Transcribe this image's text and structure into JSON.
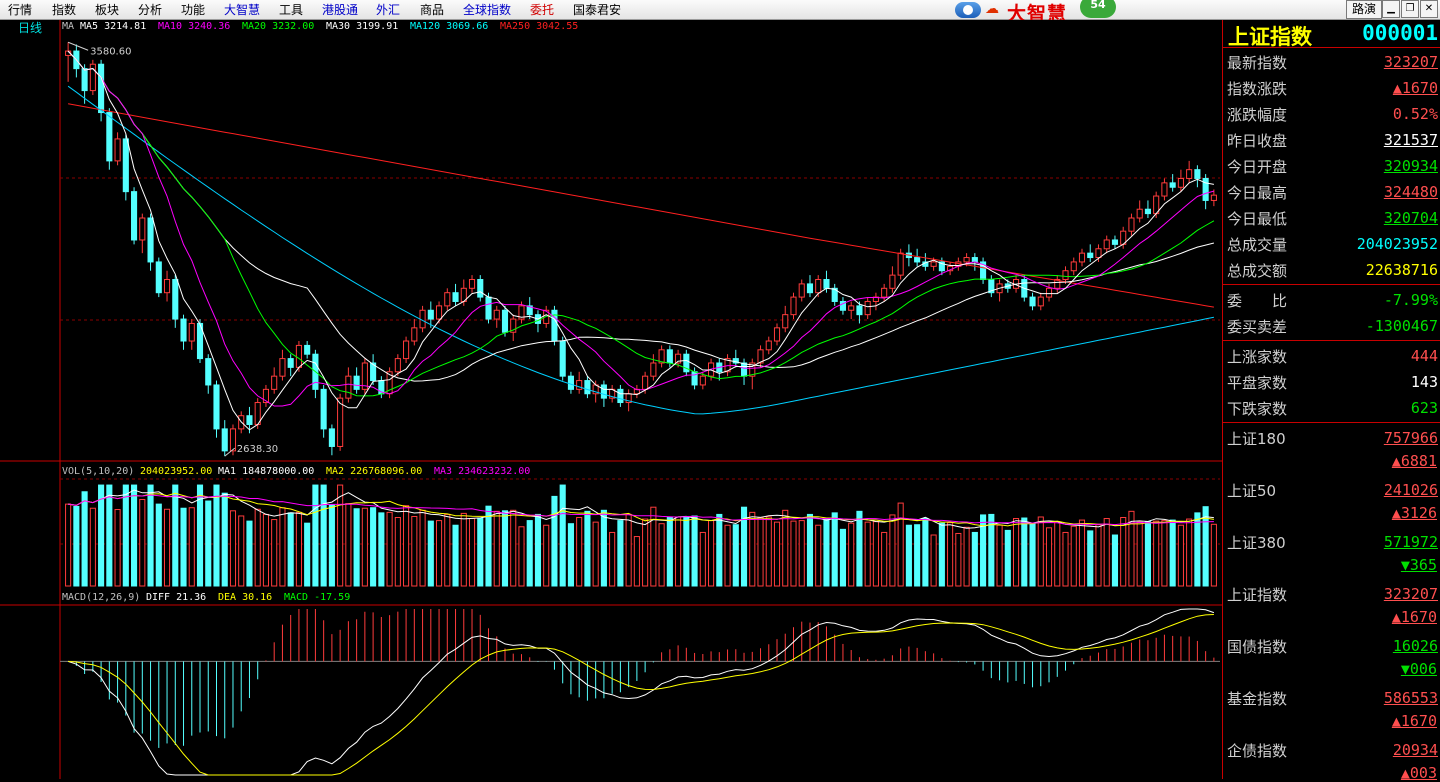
{
  "menu": [
    "行情",
    "指数",
    "板块",
    "分析",
    "功能",
    "大智慧",
    "工具",
    "港股通",
    "外汇",
    "商品",
    "全球指数",
    "委托",
    "国泰君安"
  ],
  "brand": {
    "name": "大智慧",
    "badge": "54"
  },
  "window_buttons": {
    "route": "路演",
    "minimize": "▁",
    "restore": "❐",
    "close": "✕"
  },
  "period_label": "日线",
  "price_legend": [
    {
      "text": "MA",
      "color": "#c0c0c0"
    },
    {
      "text": "MA5  3214.81",
      "color": "#ffffff"
    },
    {
      "text": "MA10  3240.36",
      "color": "#ff00ff"
    },
    {
      "text": "MA20  3232.00",
      "color": "#00ff00"
    },
    {
      "text": "MA30  3199.91",
      "color": "#ffffff"
    },
    {
      "text": "MA120  3069.66",
      "color": "#00ffff"
    },
    {
      "text": "MA250  3042.55",
      "color": "#ff2020"
    }
  ],
  "vol_legend": [
    {
      "text": "VOL(5,10,20)",
      "color": "#c0c0c0"
    },
    {
      "text": "204023952.00",
      "color": "#ffff00"
    },
    {
      "text": "MA1  184878000.00",
      "color": "#ffffff"
    },
    {
      "text": "MA2  226768096.00",
      "color": "#ffff00"
    },
    {
      "text": "MA3  234623232.00",
      "color": "#ff00ff"
    }
  ],
  "macd_legend": [
    {
      "text": "MACD(12,26,9)",
      "color": "#c0c0c0"
    },
    {
      "text": "DIFF  21.36",
      "color": "#ffffff"
    },
    {
      "text": "DEA  30.16",
      "color": "#ffff00"
    },
    {
      "text": "MACD  -17.59",
      "color": "#00ff00"
    }
  ],
  "high_label": "3580.60",
  "low_label": "2638.30",
  "quote": {
    "name": "上证指数",
    "code": "000001",
    "rows": [
      {
        "label": "最新指数",
        "value": "323207",
        "color": "red",
        "style": "ul"
      },
      {
        "label": "指数涨跌",
        "value": "▲1670",
        "color": "red",
        "style": "ul"
      },
      {
        "label": "涨跌幅度",
        "value": "0.52%",
        "color": "red",
        "style": ""
      },
      {
        "label": "昨日收盘",
        "value": "321537",
        "color": "white",
        "style": "ul"
      },
      {
        "label": "今日开盘",
        "value": "320934",
        "color": "green",
        "style": "ul"
      },
      {
        "label": "今日最高",
        "value": "324480",
        "color": "red",
        "style": "ul"
      },
      {
        "label": "今日最低",
        "value": "320704",
        "color": "green",
        "style": "ul"
      },
      {
        "label": "总成交量",
        "value": "204023952",
        "color": "cyan",
        "style": ""
      },
      {
        "label": "总成交额",
        "value": "22638716",
        "color": "yellow",
        "style": ""
      }
    ],
    "rows2": [
      {
        "label": "委　　比",
        "value": "-7.99%",
        "color": "green"
      },
      {
        "label": "委买卖差",
        "value": "-1300467",
        "color": "green"
      }
    ],
    "rows3": [
      {
        "label": "上涨家数",
        "value": "444",
        "color": "red"
      },
      {
        "label": "平盘家数",
        "value": "143",
        "color": "white"
      },
      {
        "label": "下跌家数",
        "value": "623",
        "color": "green"
      }
    ],
    "indices": [
      {
        "label": "上证180",
        "value": "757966",
        "change": "▲6881",
        "color": "red"
      },
      {
        "label": "上证50",
        "value": "241026",
        "change": "▲3126",
        "color": "red"
      },
      {
        "label": "上证380",
        "value": "571972",
        "change": "▼365",
        "color": "green"
      },
      {
        "label": "上证指数",
        "value": "323207",
        "change": "▲1670",
        "color": "red"
      },
      {
        "label": "国债指数",
        "value": "16026",
        "change": "▼006",
        "color": "green"
      },
      {
        "label": "基金指数",
        "value": "586553",
        "change": "▲1670",
        "color": "red"
      },
      {
        "label": "企债指数",
        "value": "20934",
        "change": "▲003",
        "color": "red"
      }
    ]
  },
  "chart_data": {
    "type": "candlestick",
    "title": "上证指数 日线",
    "price_range": [
      2638.3,
      3580.6
    ],
    "volume_max": 400000000,
    "macd_range": [
      -130,
      60
    ],
    "candles": [
      [
        3550,
        3560,
        3490,
        3580
      ],
      [
        3560,
        3520,
        3500,
        3575
      ],
      [
        3520,
        3470,
        3440,
        3530
      ],
      [
        3470,
        3530,
        3460,
        3540
      ],
      [
        3530,
        3420,
        3400,
        3540
      ],
      [
        3420,
        3310,
        3290,
        3430
      ],
      [
        3310,
        3360,
        3300,
        3375
      ],
      [
        3360,
        3240,
        3220,
        3370
      ],
      [
        3240,
        3130,
        3120,
        3250
      ],
      [
        3130,
        3180,
        3100,
        3190
      ],
      [
        3180,
        3080,
        3060,
        3190
      ],
      [
        3080,
        3010,
        3000,
        3090
      ],
      [
        3010,
        3040,
        2990,
        3060
      ],
      [
        3040,
        2950,
        2930,
        3050
      ],
      [
        2950,
        2900,
        2880,
        2960
      ],
      [
        2900,
        2940,
        2880,
        2950
      ],
      [
        2940,
        2860,
        2850,
        2950
      ],
      [
        2860,
        2800,
        2780,
        2870
      ],
      [
        2800,
        2700,
        2680,
        2810
      ],
      [
        2700,
        2650,
        2638,
        2720
      ],
      [
        2650,
        2700,
        2640,
        2710
      ],
      [
        2700,
        2730,
        2690,
        2740
      ],
      [
        2730,
        2710,
        2690,
        2750
      ],
      [
        2710,
        2760,
        2700,
        2770
      ],
      [
        2760,
        2790,
        2750,
        2800
      ],
      [
        2790,
        2820,
        2780,
        2840
      ],
      [
        2820,
        2860,
        2810,
        2880
      ],
      [
        2860,
        2840,
        2820,
        2870
      ],
      [
        2840,
        2890,
        2830,
        2900
      ],
      [
        2890,
        2870,
        2860,
        2900
      ],
      [
        2870,
        2790,
        2770,
        2880
      ],
      [
        2790,
        2700,
        2680,
        2800
      ],
      [
        2700,
        2660,
        2640,
        2710
      ],
      [
        2660,
        2770,
        2650,
        2780
      ],
      [
        2770,
        2820,
        2760,
        2840
      ],
      [
        2820,
        2790,
        2780,
        2840
      ],
      [
        2790,
        2850,
        2780,
        2860
      ],
      [
        2850,
        2810,
        2800,
        2870
      ],
      [
        2810,
        2780,
        2770,
        2820
      ],
      [
        2780,
        2830,
        2770,
        2840
      ],
      [
        2830,
        2860,
        2820,
        2870
      ],
      [
        2860,
        2900,
        2850,
        2910
      ],
      [
        2900,
        2930,
        2890,
        2950
      ],
      [
        2930,
        2970,
        2920,
        2980
      ],
      [
        2970,
        2950,
        2930,
        2990
      ],
      [
        2950,
        2980,
        2940,
        2990
      ],
      [
        2980,
        3010,
        2970,
        3020
      ],
      [
        3010,
        2990,
        2980,
        3030
      ],
      [
        2990,
        3020,
        2980,
        3040
      ],
      [
        3020,
        3040,
        3010,
        3050
      ],
      [
        3040,
        3000,
        2990,
        3050
      ],
      [
        3000,
        2950,
        2940,
        3010
      ],
      [
        2950,
        2970,
        2930,
        2980
      ],
      [
        2970,
        2920,
        2910,
        2980
      ],
      [
        2920,
        2950,
        2900,
        2960
      ],
      [
        2950,
        2980,
        2940,
        2990
      ],
      [
        2980,
        2960,
        2950,
        3000
      ],
      [
        2960,
        2940,
        2920,
        2970
      ],
      [
        2940,
        2970,
        2930,
        2980
      ],
      [
        2970,
        2900,
        2890,
        2980
      ],
      [
        2900,
        2820,
        2810,
        2910
      ],
      [
        2820,
        2790,
        2780,
        2830
      ],
      [
        2790,
        2810,
        2780,
        2830
      ],
      [
        2810,
        2780,
        2770,
        2820
      ],
      [
        2780,
        2800,
        2760,
        2810
      ],
      [
        2800,
        2770,
        2750,
        2810
      ],
      [
        2770,
        2790,
        2760,
        2800
      ],
      [
        2790,
        2760,
        2750,
        2800
      ],
      [
        2760,
        2780,
        2740,
        2790
      ],
      [
        2780,
        2790,
        2770,
        2800
      ],
      [
        2790,
        2820,
        2780,
        2830
      ],
      [
        2820,
        2850,
        2810,
        2870
      ],
      [
        2850,
        2880,
        2840,
        2890
      ],
      [
        2880,
        2850,
        2840,
        2890
      ],
      [
        2850,
        2870,
        2840,
        2880
      ],
      [
        2870,
        2830,
        2820,
        2880
      ],
      [
        2830,
        2800,
        2790,
        2840
      ],
      [
        2800,
        2820,
        2790,
        2830
      ],
      [
        2820,
        2850,
        2810,
        2860
      ],
      [
        2850,
        2830,
        2810,
        2860
      ],
      [
        2830,
        2860,
        2820,
        2870
      ],
      [
        2860,
        2850,
        2840,
        2880
      ],
      [
        2850,
        2820,
        2800,
        2860
      ],
      [
        2820,
        2850,
        2790,
        2860
      ],
      [
        2850,
        2880,
        2840,
        2890
      ],
      [
        2880,
        2900,
        2870,
        2910
      ],
      [
        2900,
        2930,
        2890,
        2940
      ],
      [
        2930,
        2960,
        2920,
        2980
      ],
      [
        2960,
        3000,
        2950,
        3010
      ],
      [
        3000,
        3030,
        2990,
        3040
      ],
      [
        3030,
        3010,
        3000,
        3050
      ],
      [
        3010,
        3040,
        3000,
        3050
      ],
      [
        3040,
        3020,
        3010,
        3060
      ],
      [
        3020,
        2990,
        2980,
        3030
      ],
      [
        2990,
        2970,
        2960,
        3000
      ],
      [
        2970,
        2980,
        2950,
        2990
      ],
      [
        2980,
        2960,
        2940,
        2990
      ],
      [
        2960,
        2990,
        2950,
        3000
      ],
      [
        2990,
        3000,
        2970,
        3010
      ],
      [
        3000,
        3020,
        2990,
        3030
      ],
      [
        3020,
        3050,
        3010,
        3070
      ],
      [
        3050,
        3100,
        3040,
        3110
      ],
      [
        3100,
        3090,
        3070,
        3120
      ],
      [
        3090,
        3080,
        3070,
        3110
      ],
      [
        3080,
        3070,
        3060,
        3100
      ],
      [
        3070,
        3080,
        3060,
        3090
      ],
      [
        3080,
        3060,
        3050,
        3090
      ],
      [
        3060,
        3070,
        3050,
        3080
      ],
      [
        3070,
        3080,
        3060,
        3090
      ],
      [
        3080,
        3090,
        3070,
        3100
      ],
      [
        3090,
        3080,
        3060,
        3100
      ],
      [
        3080,
        3040,
        3030,
        3090
      ],
      [
        3040,
        3010,
        3000,
        3050
      ],
      [
        3010,
        3030,
        2990,
        3040
      ],
      [
        3030,
        3020,
        3010,
        3040
      ],
      [
        3020,
        3040,
        3010,
        3050
      ],
      [
        3040,
        3000,
        2990,
        3050
      ],
      [
        3000,
        2980,
        2970,
        3010
      ],
      [
        2980,
        3000,
        2970,
        3010
      ],
      [
        3000,
        3020,
        2990,
        3030
      ],
      [
        3020,
        3040,
        3010,
        3050
      ],
      [
        3040,
        3060,
        3030,
        3070
      ],
      [
        3060,
        3080,
        3050,
        3090
      ],
      [
        3080,
        3100,
        3070,
        3110
      ],
      [
        3100,
        3090,
        3080,
        3120
      ],
      [
        3090,
        3110,
        3080,
        3120
      ],
      [
        3110,
        3130,
        3100,
        3140
      ],
      [
        3130,
        3120,
        3110,
        3140
      ],
      [
        3120,
        3150,
        3110,
        3160
      ],
      [
        3150,
        3180,
        3140,
        3190
      ],
      [
        3180,
        3200,
        3170,
        3220
      ],
      [
        3200,
        3190,
        3180,
        3220
      ],
      [
        3190,
        3230,
        3180,
        3240
      ],
      [
        3230,
        3260,
        3220,
        3270
      ],
      [
        3260,
        3250,
        3240,
        3280
      ],
      [
        3250,
        3270,
        3240,
        3290
      ],
      [
        3270,
        3290,
        3260,
        3310
      ],
      [
        3290,
        3270,
        3250,
        3300
      ],
      [
        3270,
        3220,
        3200,
        3280
      ],
      [
        3220,
        3232,
        3207,
        3245
      ]
    ]
  }
}
